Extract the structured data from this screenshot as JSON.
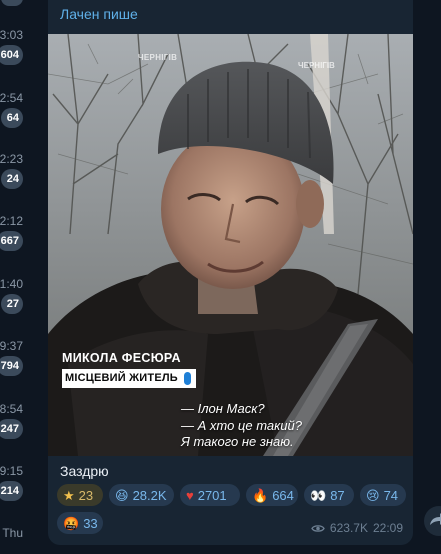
{
  "left_column": {
    "items": [
      {
        "time": "3:03",
        "badge": "604"
      },
      {
        "time": "2:54",
        "badge": "64"
      },
      {
        "time": "2:23",
        "badge": "24"
      },
      {
        "time": "2:12",
        "badge": "667"
      },
      {
        "time": "1:40",
        "badge": "27"
      },
      {
        "time": "9:37",
        "badge": "794"
      },
      {
        "time": "8:54",
        "badge": "247"
      },
      {
        "time": "9:15",
        "badge": "214"
      },
      {
        "time": "Thu",
        "badge": ""
      }
    ]
  },
  "message": {
    "sender": "Лачен пише",
    "video": {
      "person_name": "МИКОЛА ФЕСЮРА",
      "person_role": "МІСЦЕВИЙ ЖИТЕЛЬ",
      "subtitle_lines": [
        "— Ілон Маск?",
        "— А хто це такий?",
        "Я такого не знаю."
      ]
    },
    "caption": "Заздрю",
    "reactions": [
      {
        "icon": "star-icon",
        "glyph": "★",
        "count": "23",
        "type": "star"
      },
      {
        "icon": "grinning-face-icon",
        "glyph": "😆",
        "count": "28.2K",
        "type": "normal"
      },
      {
        "icon": "heart-icon",
        "glyph": "♥",
        "count": "2701",
        "type": "normal"
      },
      {
        "icon": "fire-icon",
        "glyph": "🔥",
        "count": "664",
        "type": "normal"
      },
      {
        "icon": "eyes-icon",
        "glyph": "👀",
        "count": "87",
        "type": "normal"
      },
      {
        "icon": "crying-face-icon",
        "glyph": "😢",
        "count": "74",
        "type": "normal"
      },
      {
        "icon": "angry-face-icon",
        "glyph": "🤬",
        "count": "33",
        "type": "normal"
      }
    ],
    "views": "623.7K",
    "time": "22:09"
  },
  "colors": {
    "background": "#0e1621",
    "bubble": "#182533",
    "sender": "#5fb0e8",
    "reaction_bg": "#26394f",
    "reaction_text": "#79b8ec"
  }
}
